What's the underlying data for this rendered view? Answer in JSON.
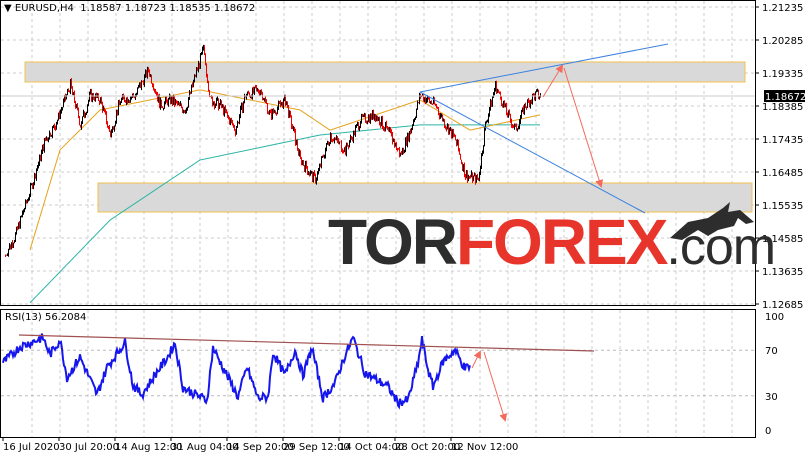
{
  "header": {
    "symbol": "EURUSD,H4",
    "open": "1.18587",
    "high": "1.18723",
    "low": "1.18535",
    "close": "1.18672"
  },
  "logo": {
    "part1": "TOR",
    "part2": "FOREX",
    "part3": ".com"
  },
  "chart_data": [
    {
      "type": "candlestick",
      "title": "EURUSD,H4",
      "current_price": "1.18672",
      "y_ticks": [
        "1.21235",
        "1.20285",
        "1.19335",
        "1.18385",
        "1.17435",
        "1.16485",
        "1.15535",
        "1.14585",
        "1.13635",
        "1.12685"
      ],
      "ylim": [
        1.12685,
        1.21235
      ],
      "x_ticks": [
        "16 Jul 2020",
        "30 Jul 20:00",
        "14 Aug 12:00",
        "31 Aug 04:00",
        "14 Sep 20:00",
        "29 Sep 12:00",
        "14 Oct 04:00",
        "28 Oct 20:00",
        "12 Nov 12:00"
      ],
      "close_keypoints": {
        "bar": [
          2,
          12,
          27,
          42,
          52,
          67,
          77,
          87,
          97,
          107,
          117,
          132,
          145,
          157,
          167,
          182,
          192,
          200,
          207,
          217,
          232,
          242,
          257,
          267,
          282,
          297,
          312,
          327,
          342,
          357,
          372,
          387,
          397,
          407,
          417,
          432,
          442,
          452,
          462,
          475,
          482,
          492,
          502,
          512,
          522,
          532,
          537
        ],
        "price": [
          1.141,
          1.1467,
          1.1597,
          1.1741,
          1.1784,
          1.1899,
          1.1784,
          1.187,
          1.1856,
          1.1755,
          1.1856,
          1.187,
          1.1942,
          1.1841,
          1.1856,
          1.1827,
          1.1928,
          1.2,
          1.1856,
          1.1841,
          1.1769,
          1.187,
          1.1885,
          1.1813,
          1.1856,
          1.1683,
          1.1626,
          1.1755,
          1.1712,
          1.1798,
          1.1813,
          1.1755,
          1.1697,
          1.1769,
          1.187,
          1.1841,
          1.1784,
          1.1741,
          1.164,
          1.1626,
          1.1784,
          1.1899,
          1.1827,
          1.1769,
          1.1841,
          1.187,
          1.1867
        ]
      },
      "ma_fast": {
        "bar": [
          27,
          57,
          97,
          197,
          297,
          327,
          417,
          467,
          537
        ],
        "price": [
          1.1424,
          1.1712,
          1.1827,
          1.1885,
          1.1827,
          1.1769,
          1.1856,
          1.1769,
          1.1813
        ]
      },
      "ma_slow": {
        "bar": [
          27,
          107,
          197,
          317,
          417,
          537
        ],
        "price": [
          1.1272,
          1.151,
          1.1683,
          1.1755,
          1.1784,
          1.1784
        ]
      },
      "zones": [
        {
          "from": 1.19076,
          "to": 1.19652
        },
        {
          "from": 1.15333,
          "to": 1.16168
        }
      ]
    },
    {
      "type": "line",
      "title": "RSI(13)",
      "label": "RSI(13) 56.2084",
      "value": "56.2084",
      "ylim": [
        0,
        100
      ],
      "y_ticks": [
        "100",
        "70",
        "30",
        "0"
      ],
      "bar": [
        0,
        17,
        40,
        47,
        57,
        64,
        77,
        94,
        104,
        122,
        130,
        139,
        154,
        164,
        172,
        180,
        204,
        210,
        235,
        244,
        255,
        265,
        270,
        282,
        292,
        300,
        309,
        320,
        332,
        340,
        350,
        362,
        385,
        395,
        405,
        415,
        419,
        425,
        430,
        440,
        452,
        462,
        467
      ],
      "rsi": [
        59,
        73,
        81,
        66,
        79,
        46,
        64,
        31,
        55,
        77,
        39,
        31,
        51,
        63,
        76,
        37,
        26,
        72,
        29,
        55,
        28,
        29,
        68,
        48,
        70,
        48,
        72,
        28,
        41,
        61,
        81,
        50,
        38,
        24,
        26,
        59,
        79,
        53,
        38,
        60,
        70,
        54,
        56.2
      ]
    }
  ]
}
